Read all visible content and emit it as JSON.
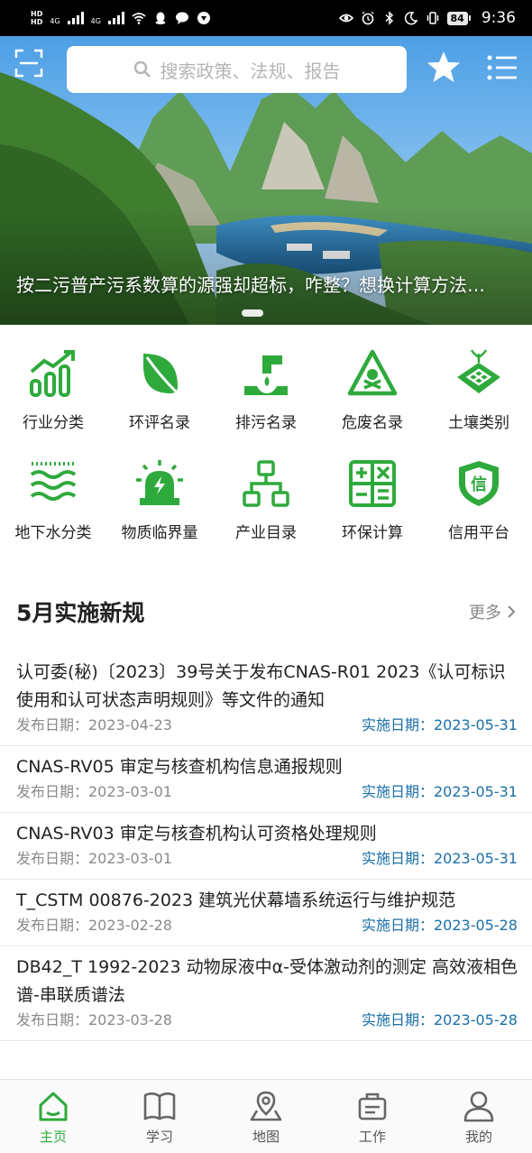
{
  "status_bar": {
    "hd_label": "HD",
    "net1": "4G",
    "net2": "4G",
    "battery": "84",
    "time": "9:36"
  },
  "search": {
    "placeholder": "搜索政策、法规、报告"
  },
  "banner": {
    "caption": "按二污普产污系数算的源强却超标，咋整？想换计算方法…"
  },
  "grid": [
    {
      "label": "行业分类",
      "icon": "bar-chart-icon"
    },
    {
      "label": "环评名录",
      "icon": "leaf-icon"
    },
    {
      "label": "排污名录",
      "icon": "discharge-pipe-icon"
    },
    {
      "label": "危废名录",
      "icon": "hazard-warning-icon"
    },
    {
      "label": "土壤类别",
      "icon": "soil-plant-icon"
    },
    {
      "label": "地下水分类",
      "icon": "groundwater-waves-icon"
    },
    {
      "label": "物质临界量",
      "icon": "alarm-light-icon"
    },
    {
      "label": "产业目录",
      "icon": "org-chart-icon"
    },
    {
      "label": "环保计算",
      "icon": "calculator-icon"
    },
    {
      "label": "信用平台",
      "icon": "credit-shield-icon"
    }
  ],
  "section": {
    "title": "5月实施新规",
    "more": "更多"
  },
  "news": [
    {
      "title": "认可委(秘)〔2023〕39号关于发布CNAS-R01 2023《认可标识使用和认可状态声明规则》等文件的通知",
      "pub": "发布日期：2023-04-23",
      "impl": "实施日期：2023-05-31"
    },
    {
      "title": "CNAS-RV05 审定与核查机构信息通报规则",
      "pub": "发布日期：2023-03-01",
      "impl": "实施日期：2023-05-31"
    },
    {
      "title": "CNAS-RV03 审定与核查机构认可资格处理规则",
      "pub": "发布日期：2023-03-01",
      "impl": "实施日期：2023-05-31"
    },
    {
      "title": "T_CSTM 00876-2023 建筑光伏幕墙系统运行与维护规范",
      "pub": "发布日期：2023-02-28",
      "impl": "实施日期：2023-05-28"
    },
    {
      "title": "DB42_T 1992-2023 动物尿液中α-受体激动剂的测定 高效液相色谱-串联质谱法",
      "pub": "发布日期：2023-03-28",
      "impl": "实施日期：2023-05-28"
    }
  ],
  "nav": [
    {
      "label": "主页",
      "icon": "home-icon",
      "active": true
    },
    {
      "label": "学习",
      "icon": "book-icon",
      "active": false
    },
    {
      "label": "地图",
      "icon": "map-icon",
      "active": false
    },
    {
      "label": "工作",
      "icon": "briefcase-icon",
      "active": false
    },
    {
      "label": "我的",
      "icon": "user-icon",
      "active": false
    }
  ],
  "colors": {
    "accent": "#2eaa3c",
    "impl_date": "#1a6fa8",
    "muted": "#8a8a8a"
  }
}
